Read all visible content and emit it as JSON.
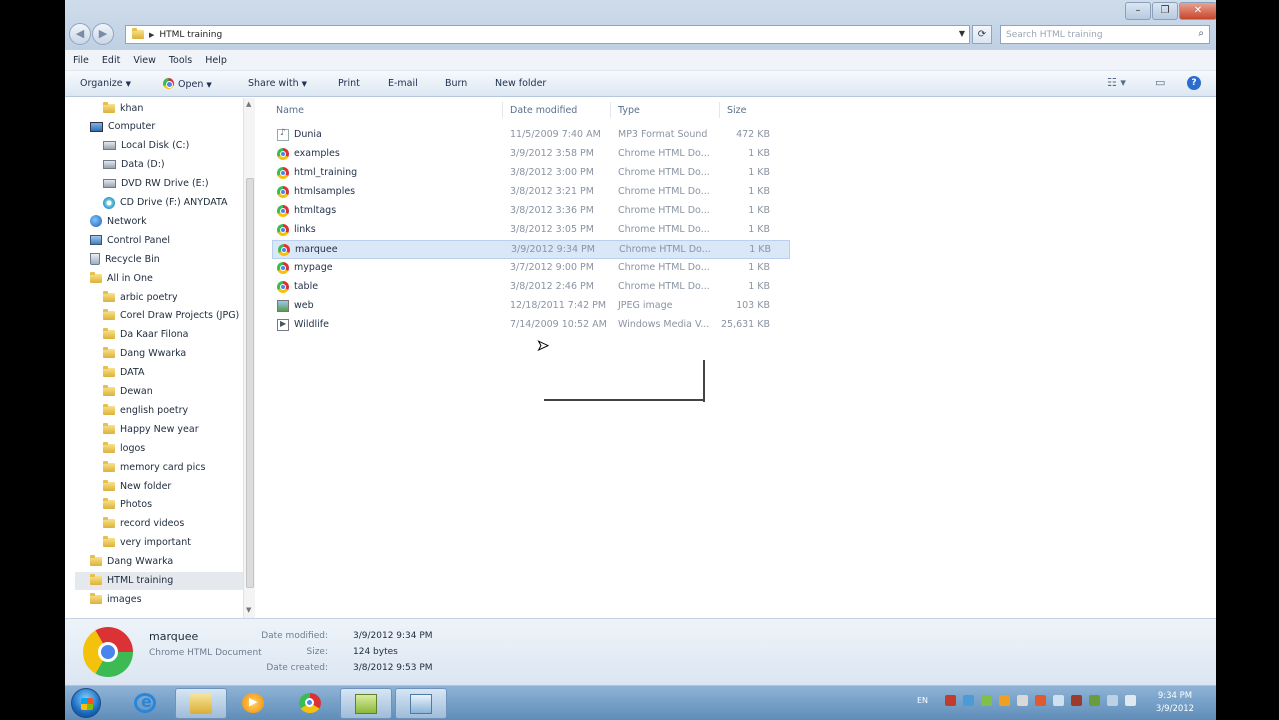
{
  "address": {
    "path": "HTML training",
    "search_placeholder": "Search HTML training"
  },
  "menu": [
    "File",
    "Edit",
    "View",
    "Tools",
    "Help"
  ],
  "toolbar": {
    "organize": "Organize",
    "open": "Open",
    "share_with": "Share with",
    "print": "Print",
    "email": "E-mail",
    "burn": "Burn",
    "new_folder": "New folder"
  },
  "nav": [
    {
      "label": "khan",
      "icon": "folder-icon",
      "indent": 1
    },
    {
      "label": "Computer",
      "icon": "computer-icon",
      "indent": 0
    },
    {
      "label": "Local Disk (C:)",
      "icon": "drive-icon",
      "indent": 1
    },
    {
      "label": "Data (D:)",
      "icon": "drive-icon",
      "indent": 1
    },
    {
      "label": "DVD RW Drive (E:)",
      "icon": "drive-icon",
      "indent": 1
    },
    {
      "label": "CD Drive (F:) ANYDATA",
      "icon": "disc-icon",
      "indent": 1
    },
    {
      "label": "Network",
      "icon": "network-icon",
      "indent": 0
    },
    {
      "label": "Control Panel",
      "icon": "control-panel-icon",
      "indent": 0
    },
    {
      "label": "Recycle Bin",
      "icon": "recycle-bin-icon",
      "indent": 0
    },
    {
      "label": "All in One",
      "icon": "folder-icon",
      "indent": 0
    },
    {
      "label": "arbic poetry",
      "icon": "folder-icon",
      "indent": 1
    },
    {
      "label": "Corel Draw Projects (JPG)",
      "icon": "folder-icon",
      "indent": 1
    },
    {
      "label": "Da Kaar Filona",
      "icon": "folder-icon",
      "indent": 1
    },
    {
      "label": "Dang Wwarka",
      "icon": "folder-icon",
      "indent": 1
    },
    {
      "label": "DATA",
      "icon": "folder-icon",
      "indent": 1
    },
    {
      "label": "Dewan",
      "icon": "folder-icon",
      "indent": 1
    },
    {
      "label": "english poetry",
      "icon": "folder-icon",
      "indent": 1
    },
    {
      "label": "Happy New year",
      "icon": "folder-icon",
      "indent": 1
    },
    {
      "label": "logos",
      "icon": "folder-icon",
      "indent": 1
    },
    {
      "label": "memory card pics",
      "icon": "folder-icon",
      "indent": 1
    },
    {
      "label": "New folder",
      "icon": "folder-icon",
      "indent": 1
    },
    {
      "label": "Photos",
      "icon": "folder-icon",
      "indent": 1
    },
    {
      "label": "record videos",
      "icon": "folder-icon",
      "indent": 1
    },
    {
      "label": "very important",
      "icon": "folder-icon",
      "indent": 1
    },
    {
      "label": "Dang Wwarka",
      "icon": "folder-icon",
      "indent": 0
    },
    {
      "label": "HTML training",
      "icon": "folder-icon",
      "indent": 0,
      "selected": true
    },
    {
      "label": "images",
      "icon": "folder-icon",
      "indent": 0
    }
  ],
  "columns": {
    "name": "Name",
    "date": "Date modified",
    "type": "Type",
    "size": "Size"
  },
  "files": [
    {
      "name": "Dunia",
      "date": "11/5/2009 7:40 AM",
      "type": "MP3 Format Sound",
      "size": "472 KB",
      "icon": "mp3-icon"
    },
    {
      "name": "examples",
      "date": "3/9/2012 3:58 PM",
      "type": "Chrome HTML Do...",
      "size": "1 KB",
      "icon": "chrome-icon"
    },
    {
      "name": "html_training",
      "date": "3/8/2012 3:00 PM",
      "type": "Chrome HTML Do...",
      "size": "1 KB",
      "icon": "chrome-icon"
    },
    {
      "name": "htmlsamples",
      "date": "3/8/2012 3:21 PM",
      "type": "Chrome HTML Do...",
      "size": "1 KB",
      "icon": "chrome-icon"
    },
    {
      "name": "htmltags",
      "date": "3/8/2012 3:36 PM",
      "type": "Chrome HTML Do...",
      "size": "1 KB",
      "icon": "chrome-icon"
    },
    {
      "name": "links",
      "date": "3/8/2012 3:05 PM",
      "type": "Chrome HTML Do...",
      "size": "1 KB",
      "icon": "chrome-icon"
    },
    {
      "name": "marquee",
      "date": "3/9/2012 9:34 PM",
      "type": "Chrome HTML Do...",
      "size": "1 KB",
      "icon": "chrome-icon",
      "selected": true
    },
    {
      "name": "mypage",
      "date": "3/7/2012 9:00 PM",
      "type": "Chrome HTML Do...",
      "size": "1 KB",
      "icon": "chrome-icon"
    },
    {
      "name": "table",
      "date": "3/8/2012 2:46 PM",
      "type": "Chrome HTML Do...",
      "size": "1 KB",
      "icon": "chrome-icon"
    },
    {
      "name": "web",
      "date": "12/18/2011 7:42 PM",
      "type": "JPEG image",
      "size": "103 KB",
      "icon": "jpeg-icon"
    },
    {
      "name": "Wildlife",
      "date": "7/14/2009 10:52 AM",
      "type": "Windows Media V...",
      "size": "25,631 KB",
      "icon": "video-icon"
    }
  ],
  "details": {
    "name": "marquee",
    "type": "Chrome HTML Document",
    "date_modified_label": "Date modified:",
    "date_modified": "3/9/2012 9:34 PM",
    "size_label": "Size:",
    "size": "124 bytes",
    "date_created_label": "Date created:",
    "date_created": "3/8/2012 9:53 PM"
  },
  "taskbar": {
    "language": "EN",
    "time": "9:34 PM",
    "date": "3/9/2012"
  }
}
